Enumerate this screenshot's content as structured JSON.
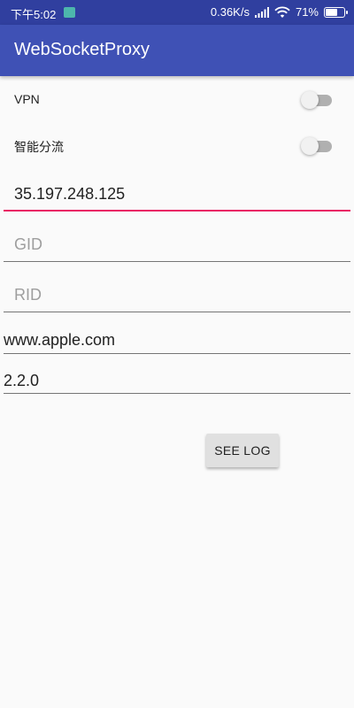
{
  "status_bar": {
    "time": "下午5:02",
    "net_speed": "0.36K/s",
    "battery": "71%",
    "battery_level": 0.71
  },
  "app_bar": {
    "title": "WebSocketProxy"
  },
  "settings": {
    "vpn": {
      "label": "VPN",
      "enabled": false
    },
    "smart_split": {
      "label": "智能分流",
      "enabled": false
    }
  },
  "fields": {
    "server_ip": {
      "value": "35.197.248.125",
      "placeholder": ""
    },
    "gid": {
      "value": "",
      "placeholder": "GID"
    },
    "rid": {
      "value": "",
      "placeholder": "RID"
    },
    "host": {
      "value": "www.apple.com"
    },
    "version": {
      "value": "2.2.0"
    }
  },
  "actions": {
    "see_log_label": "SEE LOG"
  },
  "colors": {
    "primary": "#3f51b5",
    "primary_dark": "#303f9f",
    "accent": "#e91e63"
  }
}
